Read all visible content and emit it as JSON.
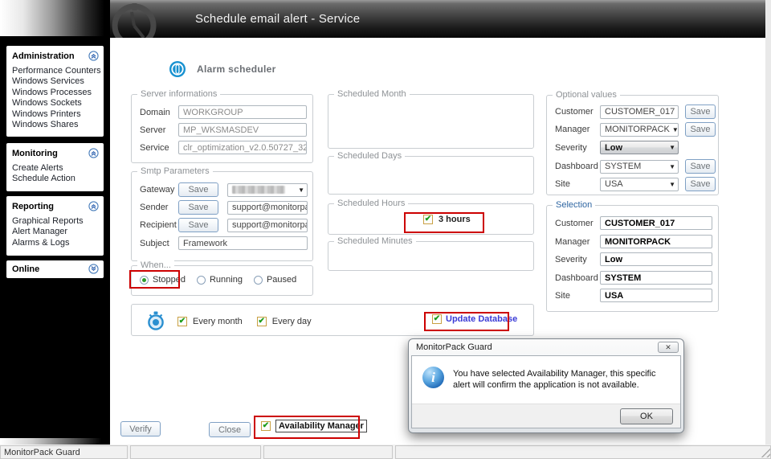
{
  "header": {
    "title": "Schedule email alert - Service"
  },
  "sidebar": {
    "sections": [
      {
        "title": "Administration",
        "items": [
          "Performance Counters",
          "Windows Services",
          "Windows Processes",
          "Windows Sockets",
          "Windows Printers",
          "Windows Shares"
        ]
      },
      {
        "title": "Monitoring",
        "items": [
          "Create Alerts",
          "Schedule Action"
        ]
      },
      {
        "title": "Reporting",
        "items": [
          "Graphical Reports",
          "Alert Manager",
          "Alarms & Logs"
        ]
      },
      {
        "title": "Online",
        "items": []
      }
    ]
  },
  "page": {
    "title": "Alarm scheduler"
  },
  "server_info": {
    "legend": "Server informations",
    "rows": [
      {
        "label": "Domain",
        "value": "WORKGROUP"
      },
      {
        "label": "Server",
        "value": "MP_WKSMASDEV"
      },
      {
        "label": "Service",
        "value": "clr_optimization_v2.0.50727_32"
      }
    ]
  },
  "smtp": {
    "legend": "Smtp Parameters",
    "save_label": "Save",
    "gateway_label": "Gateway",
    "sender_label": "Sender",
    "recipient_label": "Recipient",
    "subject_label": "Subject",
    "gateway_value_censored": true,
    "sender_value": "support@monitorpa",
    "recipient_value": "support@monitorpa",
    "subject_value": "Framework"
  },
  "when": {
    "legend": "When...",
    "stopped": "Stopped",
    "running": "Running",
    "paused": "Paused",
    "selected": "Stopped"
  },
  "scheduled": {
    "month_legend": "Scheduled Month",
    "days_legend": "Scheduled Days",
    "hours_legend": "Scheduled Hours",
    "hours_option": "3 hours",
    "hours_checked": true,
    "minutes_legend": "Scheduled Minutes"
  },
  "recurrence": {
    "every_month": "Every month",
    "every_day": "Every day",
    "update_database": "Update Database",
    "all_checked": true
  },
  "optional": {
    "legend": "Optional values",
    "save_label": "Save",
    "rows": [
      {
        "label": "Customer",
        "value": "CUSTOMER_017"
      },
      {
        "label": "Manager",
        "value": "MONITORPACK"
      },
      {
        "label": "Severity",
        "value": "Low"
      },
      {
        "label": "Dashboard",
        "value": "SYSTEM"
      },
      {
        "label": "Site",
        "value": "USA"
      }
    ]
  },
  "selection": {
    "legend": "Selection",
    "rows": [
      {
        "label": "Customer",
        "value": "CUSTOMER_017"
      },
      {
        "label": "Manager",
        "value": "MONITORPACK"
      },
      {
        "label": "Severity",
        "value": "Low"
      },
      {
        "label": "Dashboard",
        "value": "SYSTEM"
      },
      {
        "label": "Site",
        "value": "USA"
      }
    ]
  },
  "footer": {
    "verify": "Verify",
    "close": "Close",
    "availability": "Availability Manager",
    "availability_checked": true
  },
  "dialog": {
    "title": "MonitorPack Guard",
    "message": "You have selected Availability Manager, this specific alert will confirm the application is not available.",
    "ok": "OK"
  },
  "statusbar": {
    "text": "MonitorPack Guard"
  },
  "colors": {
    "annotation": "#cc0000",
    "accent_blue": "#1791d0",
    "update_db_link": "#3b3bd6"
  }
}
